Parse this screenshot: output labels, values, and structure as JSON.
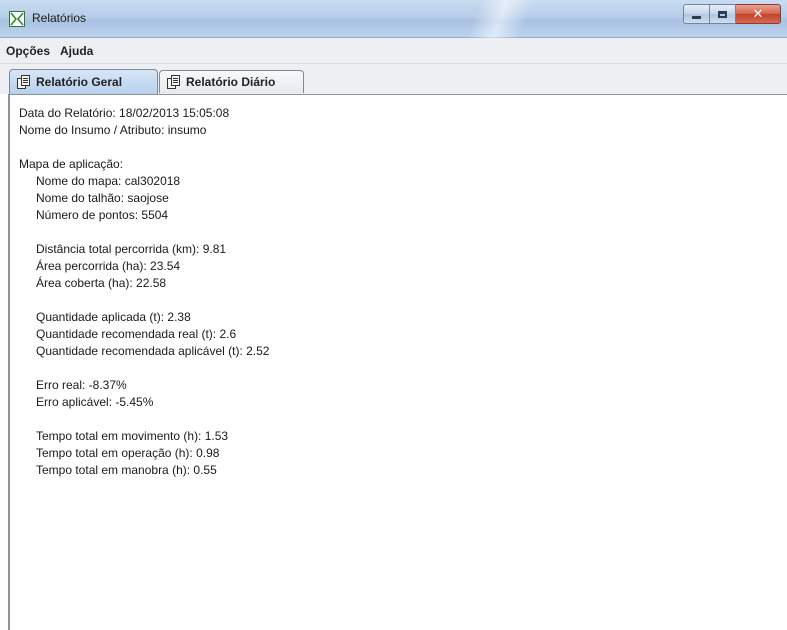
{
  "window": {
    "title": "Relatórios",
    "controls": [
      "minimize",
      "maximize",
      "close"
    ]
  },
  "menu": [
    "Opções",
    "Ajuda"
  ],
  "tabs": [
    {
      "label": "Relatório Geral",
      "active": true,
      "icon": "documents-icon"
    },
    {
      "label": "Relatório Diário",
      "active": false,
      "icon": "documents-icon"
    }
  ],
  "report": {
    "date_line": "Data do Relatório: 18/02/2013 15:05:08",
    "input_line": "Nome do Insumo / Atributo: insumo",
    "map_heading": "Mapa de aplicação:",
    "map_name": "Nome do mapa: cal302018",
    "field_name": "Nome do talhão: saojose",
    "point_count": "Número de pontos: 5504",
    "distance": "Distância total percorrida (km): 9.81",
    "area_travelled": "Área percorrida (ha): 23.54",
    "area_covered": "Área coberta (ha): 22.58",
    "qty_applied": "Quantidade aplicada (t): 2.38",
    "qty_recommended_real": "Quantidade recomendada real (t): 2.6",
    "qty_recommended_applicable": "Quantidade recomendada aplicável (t): 2.52",
    "error_real": "Erro real: -8.37%",
    "error_applicable": "Erro aplicável: -5.45%",
    "time_moving": "Tempo total em movimento (h): 1.53",
    "time_operation": "Tempo total em operação (h): 0.98",
    "time_maneuver": "Tempo total em manobra (h): 0.55"
  }
}
